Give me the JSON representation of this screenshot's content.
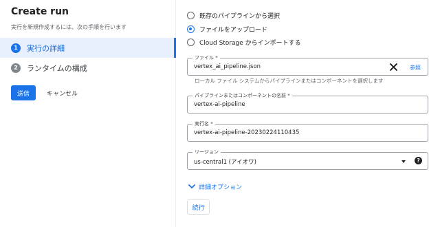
{
  "header": {
    "title": "Create run",
    "subtitle": "実行を新規作成するには、次の手順を行います"
  },
  "steps": [
    {
      "num": "1",
      "label": "実行の詳細",
      "active": true
    },
    {
      "num": "2",
      "label": "ランタイムの構成",
      "active": false
    }
  ],
  "actions": {
    "submit_label": "送信",
    "cancel_label": "キャンセル"
  },
  "source_options": [
    {
      "label": "既存のパイプラインから選択",
      "checked": false
    },
    {
      "label": "ファイルをアップロード",
      "checked": true
    },
    {
      "label": "Cloud Storage からインポートする",
      "checked": false
    }
  ],
  "file_field": {
    "label": "ファイル *",
    "value": "vertex_ai_pipeline.json",
    "browse_label": "参照",
    "clear_icon": "close-icon",
    "hint": "ローカル ファイル システムからパイプラインまたはコンポーネントを選択します"
  },
  "pipeline_name_field": {
    "label": "パイプラインまたはコンポーネントの名前 *",
    "value": "vertex-ai-pipeline"
  },
  "run_name_field": {
    "label": "実行名 *",
    "value": "vertex-ai-pipeline-20230224110435"
  },
  "region_field": {
    "label": "リージョン",
    "value": "us-central1 (アイオワ)",
    "help_icon": "?"
  },
  "advanced": {
    "label": "詳細オプション",
    "icon": "chevron-down-icon"
  },
  "continue_label": "続行",
  "colors": {
    "accent": "#1a73e8",
    "active_bg": "#e8f0fe",
    "border": "#9aa0a6"
  }
}
